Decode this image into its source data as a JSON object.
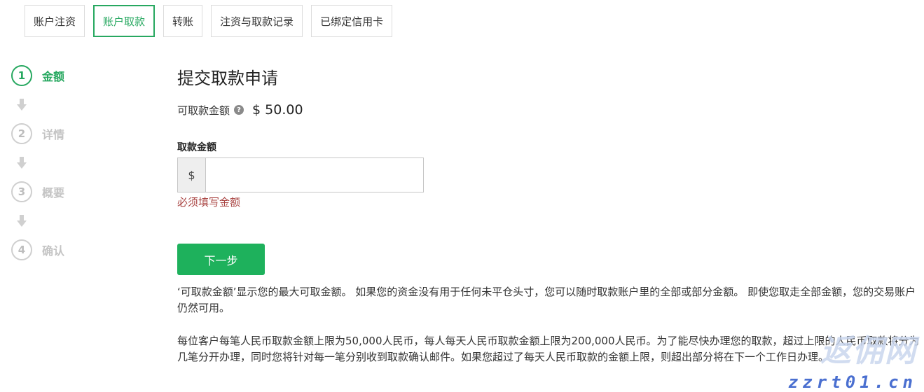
{
  "tabs": [
    {
      "label": "账户注资",
      "active": false
    },
    {
      "label": "账户取款",
      "active": true
    },
    {
      "label": "转账",
      "active": false
    },
    {
      "label": "注资与取款记录",
      "active": false
    },
    {
      "label": "已绑定信用卡",
      "active": false
    }
  ],
  "steps": [
    {
      "number": "1",
      "label": "金额",
      "active": true
    },
    {
      "number": "2",
      "label": "详情",
      "active": false
    },
    {
      "number": "3",
      "label": "概要",
      "active": false
    },
    {
      "number": "4",
      "label": "确认",
      "active": false
    }
  ],
  "main": {
    "title": "提交取款申请",
    "available_label": "可取款金额",
    "available_help_icon": "question-circle-icon",
    "available_amount": "$ 50.00",
    "field_label": "取款金额",
    "currency_symbol": "$",
    "amount_value": "",
    "amount_placeholder": "",
    "error_text": "必须填写金额",
    "next_button": "下一步",
    "paragraph1": "‘可取款金额’显示您的最大可取金额。 如果您的资金没有用于任何未平仓头寸，您可以随时取款账户里的全部或部分金额。 即使您取走全部金额，您的交易账户仍然可用。",
    "paragraph2": "每位客户每笔人民币取款金额上限为50,000人民币，每人每天人民币取款金额上限为200,000人民币。为了能尽快办理您的取款，超过上限的人民币取款将分为几笔分开办理，同时您将针对每一笔分别收到取款确认邮件。如果您超过了每天人民币取款的金额上限，则超出部分将在下一个工作日办理。"
  },
  "watermark": {
    "main": "返佣网",
    "sub": "zzrt01.cn"
  },
  "colors": {
    "accent": "#27a860",
    "button": "#1eb15c",
    "error": "#a94442",
    "inactive_step": "#c4c4c4"
  }
}
